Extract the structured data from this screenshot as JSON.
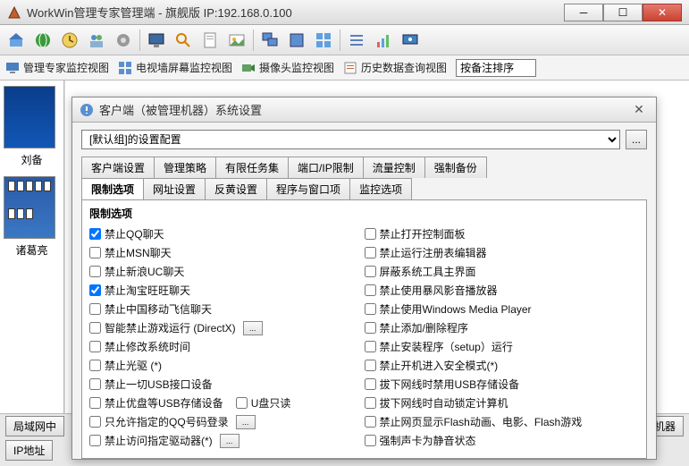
{
  "window": {
    "title": "WorkWin管理专家管理端 - 旗舰版 IP:192.168.0.100"
  },
  "viewbar": {
    "v1": "管理专家监控视图",
    "v2": "电视墙屏幕监控视图",
    "v3": "摄像头监控视图",
    "v4": "历史数据查询视图",
    "sort_label": "按备注排序"
  },
  "thumbs": {
    "t1": "刘备",
    "t2": "诸葛亮"
  },
  "bottombar": {
    "b1": "局域网中",
    "b2": "IP地址",
    "b3": "监视机器"
  },
  "dialog": {
    "title": "客户端（被管理机器）系统设置",
    "config_select": "[默认组]的设置配置",
    "config_btn": "...",
    "tabs_row1": [
      "客户端设置",
      "管理策略",
      "有限任务集",
      "端口/IP限制",
      "流量控制",
      "强制备份"
    ],
    "tabs_row2": [
      "限制选项",
      "网址设置",
      "反黄设置",
      "程序与窗口项",
      "监控选项"
    ],
    "group_title": "限制选项",
    "left_options": [
      {
        "label": "禁止QQ聊天",
        "checked": true
      },
      {
        "label": "禁止MSN聊天",
        "checked": false
      },
      {
        "label": "禁止新浪UC聊天",
        "checked": false
      },
      {
        "label": "禁止淘宝旺旺聊天",
        "checked": true
      },
      {
        "label": "禁止中国移动飞信聊天",
        "checked": false
      },
      {
        "label": "智能禁止游戏运行 (DirectX)",
        "checked": false,
        "btn": true
      },
      {
        "label": "禁止修改系统时间",
        "checked": false
      },
      {
        "label": "禁止光驱 (*)",
        "checked": false
      },
      {
        "label": "禁止一切USB接口设备",
        "checked": false
      },
      {
        "label": "禁止优盘等USB存储设备",
        "checked": false,
        "sub_label": "U盘只读",
        "sub_checked": false
      },
      {
        "label": "只允许指定的QQ号码登录",
        "checked": false,
        "btn": true
      },
      {
        "label": "禁止访问指定驱动器(*)",
        "checked": false,
        "btn": true
      }
    ],
    "right_options": [
      {
        "label": "禁止打开控制面板",
        "checked": false
      },
      {
        "label": "禁止运行注册表编辑器",
        "checked": false
      },
      {
        "label": "屏蔽系统工具主界面",
        "checked": false
      },
      {
        "label": "禁止使用暴风影音播放器",
        "checked": false
      },
      {
        "label": "禁止使用Windows Media Player",
        "checked": false
      },
      {
        "label": "禁止添加/删除程序",
        "checked": false
      },
      {
        "label": "禁止安装程序（setup）运行",
        "checked": false
      },
      {
        "label": "禁止开机进入安全模式(*)",
        "checked": false
      },
      {
        "label": "拔下网线时禁用USB存储设备",
        "checked": false
      },
      {
        "label": "拔下网线时自动锁定计算机",
        "checked": false
      },
      {
        "label": "禁止网页显示Flash动画、电影、Flash游戏",
        "checked": false
      },
      {
        "label": "强制声卡为静音状态",
        "checked": false
      }
    ]
  }
}
